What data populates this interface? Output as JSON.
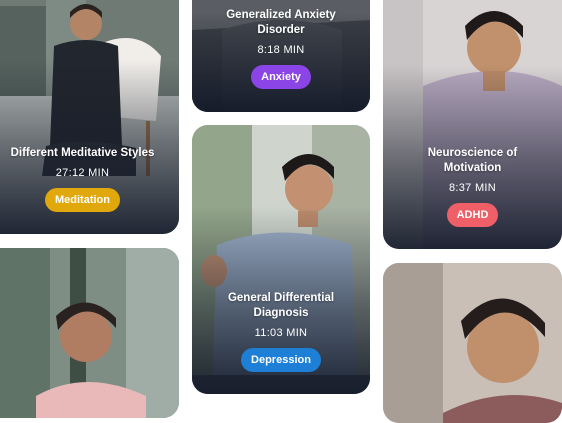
{
  "cards": [
    {
      "id": "meditative",
      "title": "Different Meditative Styles",
      "duration": "27:12 MIN",
      "tag": "Meditation",
      "tag_color": "#e1a80d"
    },
    {
      "id": "gad",
      "title": "Generalized Anxiety Disorder",
      "duration": "8:18 MIN",
      "tag": "Anxiety",
      "tag_color": "#8b45e6"
    },
    {
      "id": "motivation",
      "title": "Neuroscience of Motivation",
      "duration": "8:37 MIN",
      "tag": "ADHD",
      "tag_color": "#ee5f67"
    },
    {
      "id": "differential",
      "title": "General Differential Diagnosis",
      "duration": "11:03 MIN",
      "tag": "Depression",
      "tag_color": "#1d7fd6"
    },
    {
      "id": "bottom-left"
    },
    {
      "id": "bottom-right"
    }
  ]
}
